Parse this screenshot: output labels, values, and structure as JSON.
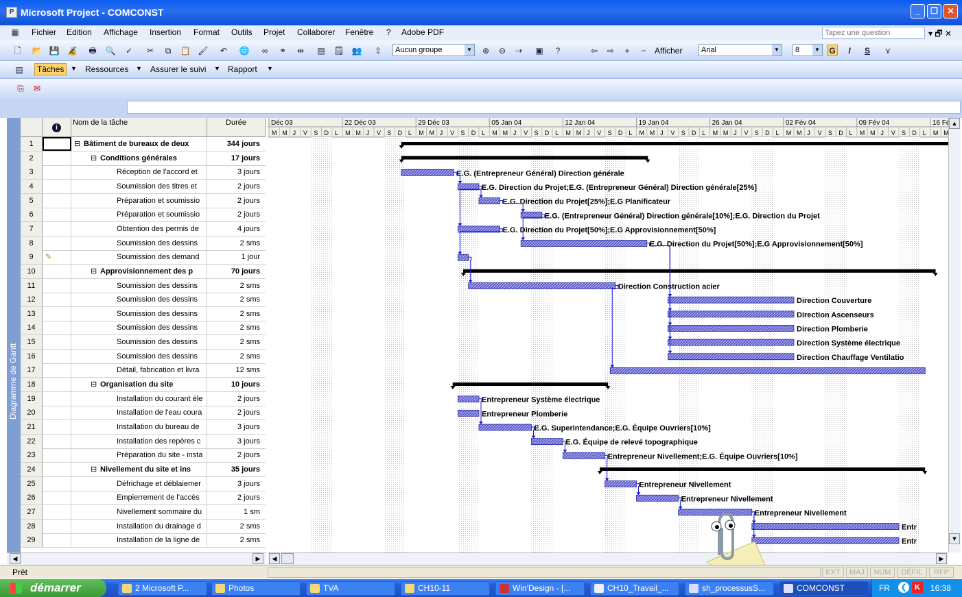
{
  "window": {
    "title": "Microsoft Project - COMCONST"
  },
  "menu": {
    "items": [
      "Fichier",
      "Edition",
      "Affichage",
      "Insertion",
      "Format",
      "Outils",
      "Projet",
      "Collaborer",
      "Fenêtre",
      "?",
      "Adobe PDF"
    ],
    "help_placeholder": "Tapez une question"
  },
  "toolbar": {
    "group_value": "Aucun groupe",
    "show_label": "Afficher",
    "font_value": "Arial",
    "size_value": "8",
    "bold": "G",
    "italic": "I",
    "underline": "S"
  },
  "guide": {
    "tasks": "Tâches",
    "resources": "Ressources",
    "track": "Assurer le suivi",
    "report": "Rapport"
  },
  "sidebar": {
    "label": "Diagramme de Gantt"
  },
  "grid": {
    "col_name": "Nom de la tâche",
    "col_duration": "Durée",
    "rows": [
      {
        "id": "1",
        "name": "Bâtiment de bureaux de deux",
        "duration": "344 jours",
        "summary": true,
        "level": 0
      },
      {
        "id": "2",
        "name": "Conditions générales",
        "duration": "17 jours",
        "summary": true,
        "level": 1
      },
      {
        "id": "3",
        "name": "Réception de l'accord et",
        "duration": "3 jours",
        "level": 2
      },
      {
        "id": "4",
        "name": "Soumission des titres et",
        "duration": "2 jours",
        "level": 2
      },
      {
        "id": "5",
        "name": "Préparation et soumissio",
        "duration": "2 jours",
        "level": 2
      },
      {
        "id": "6",
        "name": "Préparation et soumissio",
        "duration": "2 jours",
        "level": 2
      },
      {
        "id": "7",
        "name": "Obtention des permis de",
        "duration": "4 jours",
        "level": 2
      },
      {
        "id": "8",
        "name": "Soumission des dessins",
        "duration": "2 sms",
        "level": 2
      },
      {
        "id": "9",
        "name": "Soumission des demand",
        "duration": "1 jour",
        "level": 2,
        "note": true
      },
      {
        "id": "10",
        "name": "Approvisionnement des p",
        "duration": "70 jours",
        "summary": true,
        "level": 1
      },
      {
        "id": "11",
        "name": "Soumission des dessins",
        "duration": "2 sms",
        "level": 2
      },
      {
        "id": "12",
        "name": "Soumission des dessins",
        "duration": "2 sms",
        "level": 2
      },
      {
        "id": "13",
        "name": "Soumission des dessins",
        "duration": "2 sms",
        "level": 2
      },
      {
        "id": "14",
        "name": "Soumission des dessins",
        "duration": "2 sms",
        "level": 2
      },
      {
        "id": "15",
        "name": "Soumission des dessins",
        "duration": "2 sms",
        "level": 2
      },
      {
        "id": "16",
        "name": "Soumission des dessins",
        "duration": "2 sms",
        "level": 2
      },
      {
        "id": "17",
        "name": "Détail, fabrication et livra",
        "duration": "12 sms",
        "level": 2
      },
      {
        "id": "18",
        "name": "Organisation du site",
        "duration": "10 jours",
        "summary": true,
        "level": 1
      },
      {
        "id": "19",
        "name": "Installation du courant éle",
        "duration": "2 jours",
        "level": 2
      },
      {
        "id": "20",
        "name": "Installation de l'eau coura",
        "duration": "2 jours",
        "level": 2
      },
      {
        "id": "21",
        "name": "Installation du bureau de",
        "duration": "3 jours",
        "level": 2
      },
      {
        "id": "22",
        "name": "Installation des repères c",
        "duration": "3 jours",
        "level": 2
      },
      {
        "id": "23",
        "name": "Préparation du site - insta",
        "duration": "2 jours",
        "level": 2
      },
      {
        "id": "24",
        "name": "Nivellement du site et ins",
        "duration": "35 jours",
        "summary": true,
        "level": 1
      },
      {
        "id": "25",
        "name": "Défrichage et déblaiemer",
        "duration": "3 jours",
        "level": 2
      },
      {
        "id": "26",
        "name": "Empierrement de l'accès",
        "duration": "2 jours",
        "level": 2
      },
      {
        "id": "27",
        "name": "Nivellement sommaire du",
        "duration": "1 sm",
        "level": 2
      },
      {
        "id": "28",
        "name": "Installation du drainage d",
        "duration": "2 sms",
        "level": 2
      },
      {
        "id": "29",
        "name": "Installation de la ligne de",
        "duration": "2 sms",
        "level": 2
      }
    ]
  },
  "timescale": {
    "weeks": [
      "Déc 03",
      "22 Déc 03",
      "29 Déc 03",
      "05 Jan 04",
      "12 Jan 04",
      "19 Jan 04",
      "26 Jan 04",
      "02 Fév 04",
      "09 Fév 04",
      "16 Fév ("
    ],
    "days": "MMJVSDL"
  },
  "gantt_labels": [
    {
      "row": 3,
      "text": "E.G. (Entrepreneur Général) Direction générale"
    },
    {
      "row": 4,
      "text": "E.G. Direction du Projet;E.G. (Entrepreneur Général) Direction générale[25%]"
    },
    {
      "row": 5,
      "text": "E.G. Direction du Projet[25%];E.G Planificateur"
    },
    {
      "row": 6,
      "text": "E.G. (Entrepreneur Général) Direction générale[10%];E.G. Direction du Projet"
    },
    {
      "row": 7,
      "text": "E.G. Direction du Projet[50%];E.G Approvisionnement[50%]"
    },
    {
      "row": 8,
      "text": "E.G. Direction du Projet[50%];E.G Approvisionnement[50%]"
    },
    {
      "row": 11,
      "text": "Direction Construction acier"
    },
    {
      "row": 12,
      "text": "Direction Couverture"
    },
    {
      "row": 13,
      "text": "Direction Ascenseurs"
    },
    {
      "row": 14,
      "text": "Direction Plomberie"
    },
    {
      "row": 15,
      "text": "Direction Système électrique"
    },
    {
      "row": 16,
      "text": "Direction Chauffage Ventilatio"
    },
    {
      "row": 19,
      "text": "Entrepreneur Système électrique"
    },
    {
      "row": 20,
      "text": "Entrepreneur Plomberie"
    },
    {
      "row": 21,
      "text": "E.G. Superintendance;E.G. Équipe Ouvriers[10%]"
    },
    {
      "row": 22,
      "text": "E.G. Équipe de relevé topographique"
    },
    {
      "row": 23,
      "text": "Entrepreneur Nivellement;E.G. Équipe Ouvriers[10%]"
    },
    {
      "row": 25,
      "text": "Entrepreneur Nivellement"
    },
    {
      "row": 26,
      "text": "Entrepreneur Nivellement"
    },
    {
      "row": 27,
      "text": "Entrepreneur Nivellement"
    },
    {
      "row": 28,
      "text": "Entr"
    },
    {
      "row": 29,
      "text": "Entr"
    }
  ],
  "status": {
    "ready": "Prêt",
    "indicators": [
      "EXT",
      "MAJ",
      "NUM",
      "DÉFIL",
      "RFP"
    ]
  },
  "taskbar": {
    "start": "démarrer",
    "items": [
      "2 Microsoft P...",
      "Photos",
      "TVA",
      "CH10-11",
      "Win'Design - [...",
      "CH10_Travail_...",
      "sh_processusS...",
      "COMCONST"
    ],
    "lang": "FR",
    "clock": "16:38"
  }
}
